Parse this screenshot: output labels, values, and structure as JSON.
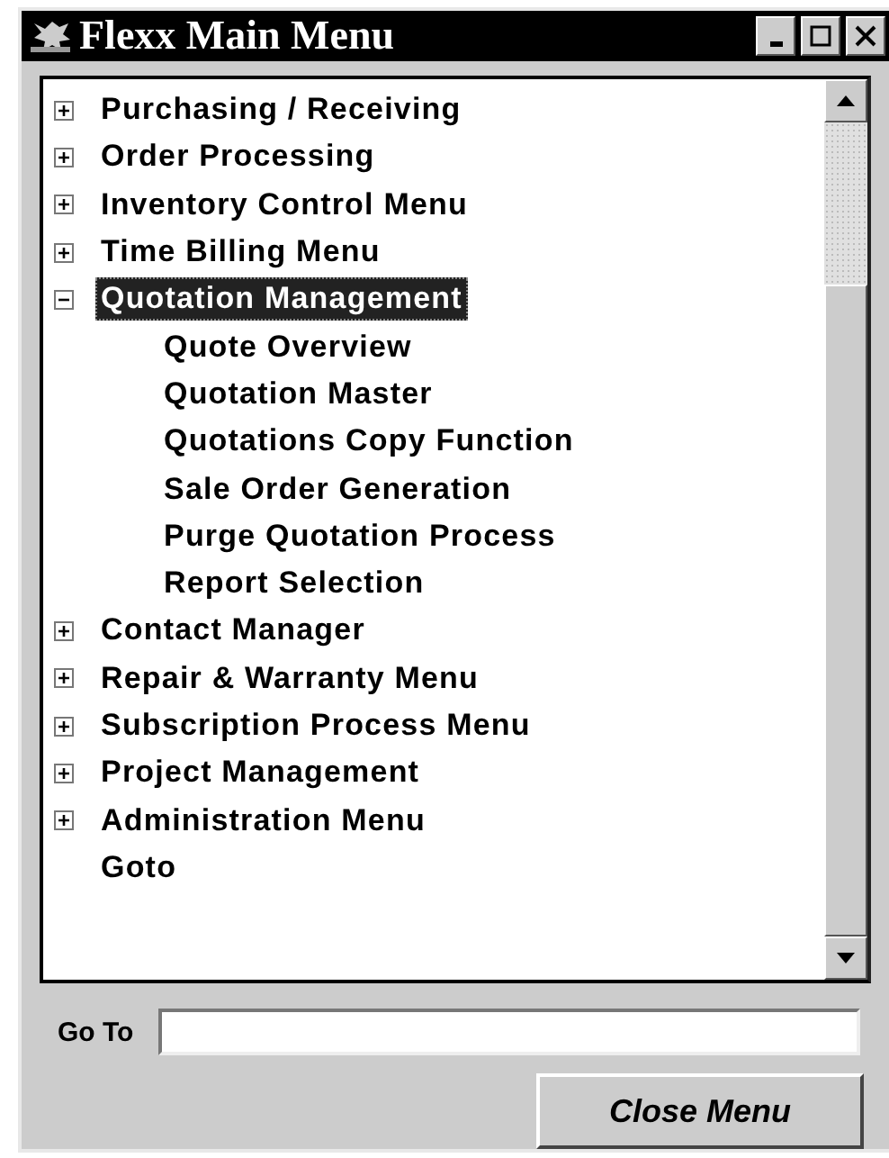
{
  "window": {
    "title": "Flexx Main Menu"
  },
  "tree": [
    {
      "label": "Purchasing / Receiving",
      "kind": "branch",
      "expanded": false,
      "selected": false
    },
    {
      "label": "Order Processing",
      "kind": "branch",
      "expanded": false,
      "selected": false
    },
    {
      "label": "Inventory Control Menu",
      "kind": "branch",
      "expanded": false,
      "selected": false
    },
    {
      "label": "Time Billing Menu",
      "kind": "branch",
      "expanded": false,
      "selected": false
    },
    {
      "label": "Quotation Management",
      "kind": "branch",
      "expanded": true,
      "selected": true,
      "children": [
        {
          "label": "Quote Overview",
          "selected": false
        },
        {
          "label": "Quotation Master",
          "selected": false
        },
        {
          "label": "Quotations Copy Function",
          "selected": false
        },
        {
          "label": "Sale Order Generation",
          "selected": false
        },
        {
          "label": "Purge Quotation Process",
          "selected": false
        },
        {
          "label": "Report Selection",
          "selected": false
        }
      ]
    },
    {
      "label": "Contact Manager",
      "kind": "branch",
      "expanded": false,
      "selected": false
    },
    {
      "label": "Repair & Warranty Menu",
      "kind": "branch",
      "expanded": false,
      "selected": false
    },
    {
      "label": "Subscription Process Menu",
      "kind": "branch",
      "expanded": false,
      "selected": false
    },
    {
      "label": "Project Management",
      "kind": "branch",
      "expanded": false,
      "selected": false
    },
    {
      "label": "Administration Menu",
      "kind": "branch",
      "expanded": false,
      "selected": false
    },
    {
      "label": "Goto",
      "kind": "leaf",
      "selected": false
    }
  ],
  "goto": {
    "label": "Go To"
  },
  "close_button": {
    "label": "Close Menu"
  }
}
